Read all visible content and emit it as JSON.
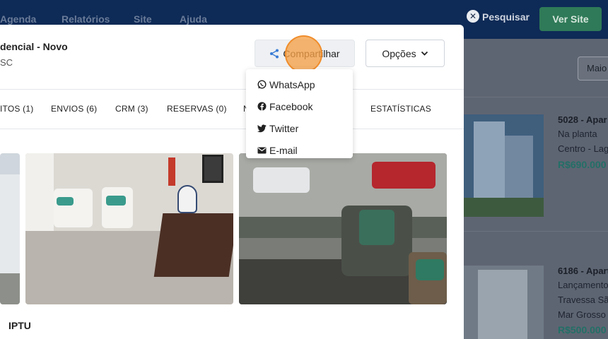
{
  "topbar": {
    "nav": [
      "Agenda",
      "Relatórios",
      "Site",
      "Ajuda"
    ],
    "search_label": "Pesquisar",
    "ver_site": "Ver Site"
  },
  "background_list": {
    "sort_button": "Maio",
    "items": [
      {
        "title": "5028 - Apar",
        "line1": "Na planta",
        "line2": "Centro - Lag",
        "price": "R$690.000"
      },
      {
        "title": "6186 - Apart",
        "line1": "Lançamento",
        "line2": "Travessa Sã",
        "line3": "Mar Grosso",
        "price": "R$500.000"
      }
    ]
  },
  "modal": {
    "title": "dencial - Novo",
    "subtitle": "SC",
    "share_button": "Compartilhar",
    "options_button": "Opções",
    "tabs": [
      "ITOS (1)",
      "ENVIOS (6)",
      "CRM (3)",
      "RESERVAS (0)",
      "N",
      "ESTATÍSTICAS"
    ],
    "iptu_label": "IPTU"
  },
  "share_menu": {
    "items": [
      {
        "label": "WhatsApp",
        "icon": "whatsapp-icon"
      },
      {
        "label": "Facebook",
        "icon": "facebook-icon"
      },
      {
        "label": "Twitter",
        "icon": "twitter-icon"
      },
      {
        "label": "E-mail",
        "icon": "mail-icon"
      }
    ]
  },
  "colors": {
    "navbar": "#0e2a56",
    "ver_site": "#2f7a58",
    "price": "#236f67",
    "click_indicator": "#f5a046"
  }
}
